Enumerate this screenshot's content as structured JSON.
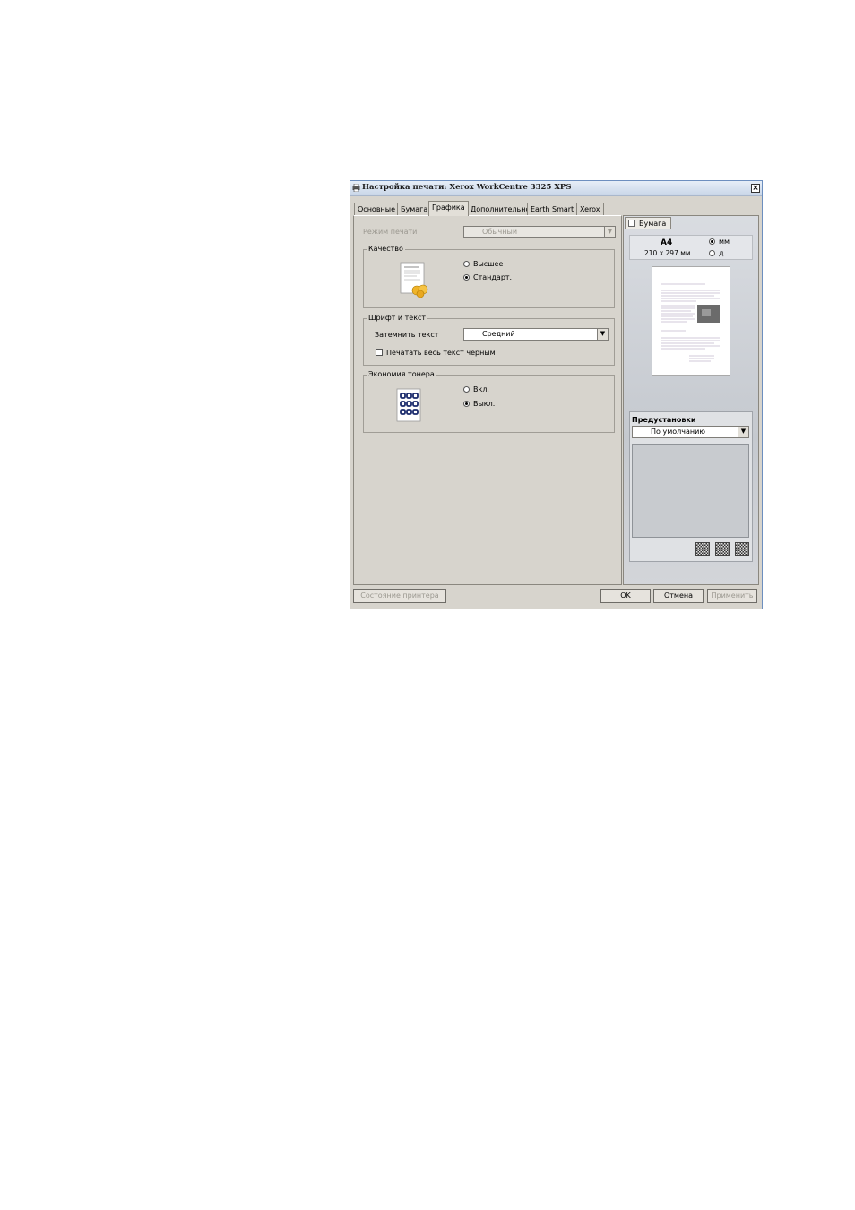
{
  "window": {
    "title": "Настройка печати: Xerox WorkCentre 3325 XPS",
    "close_label": "×"
  },
  "tabs": [
    {
      "label": "Основные"
    },
    {
      "label": "Бумага"
    },
    {
      "label": "Графика",
      "active": true
    },
    {
      "label": "Дополнительно"
    },
    {
      "label": "Earth Smart"
    },
    {
      "label": "Xerox"
    }
  ],
  "print_mode": {
    "label": "Режим печати",
    "value": "Обычный"
  },
  "quality": {
    "title": "Качество",
    "options": [
      "Высшее",
      "Стандарт."
    ],
    "selected": "Стандарт."
  },
  "font_text": {
    "title": "Шрифт и текст",
    "darken_label": "Затемнить текст",
    "darken_value": "Средний",
    "print_black_label": "Печатать весь текст черным",
    "print_black_checked": false
  },
  "toner_save": {
    "title": "Экономия тонера",
    "options": [
      "Вкл.",
      "Выкл."
    ],
    "selected": "Выкл."
  },
  "preview": {
    "tab_label": "Бумага",
    "paper_name": "A4",
    "paper_size": "210 x 297 мм",
    "units": [
      "мм",
      "д."
    ],
    "units_selected": "мм"
  },
  "presets": {
    "title": "Предустановки",
    "value": "По умолчанию"
  },
  "buttons": {
    "printer_status": "Состояние принтера",
    "ok": "OK",
    "cancel": "Отмена",
    "apply": "Применить"
  },
  "colors": {
    "dialog_bg": "#d7d4cd",
    "title_bar": "#c9d6e8",
    "window_border": "#6d8fbf"
  }
}
